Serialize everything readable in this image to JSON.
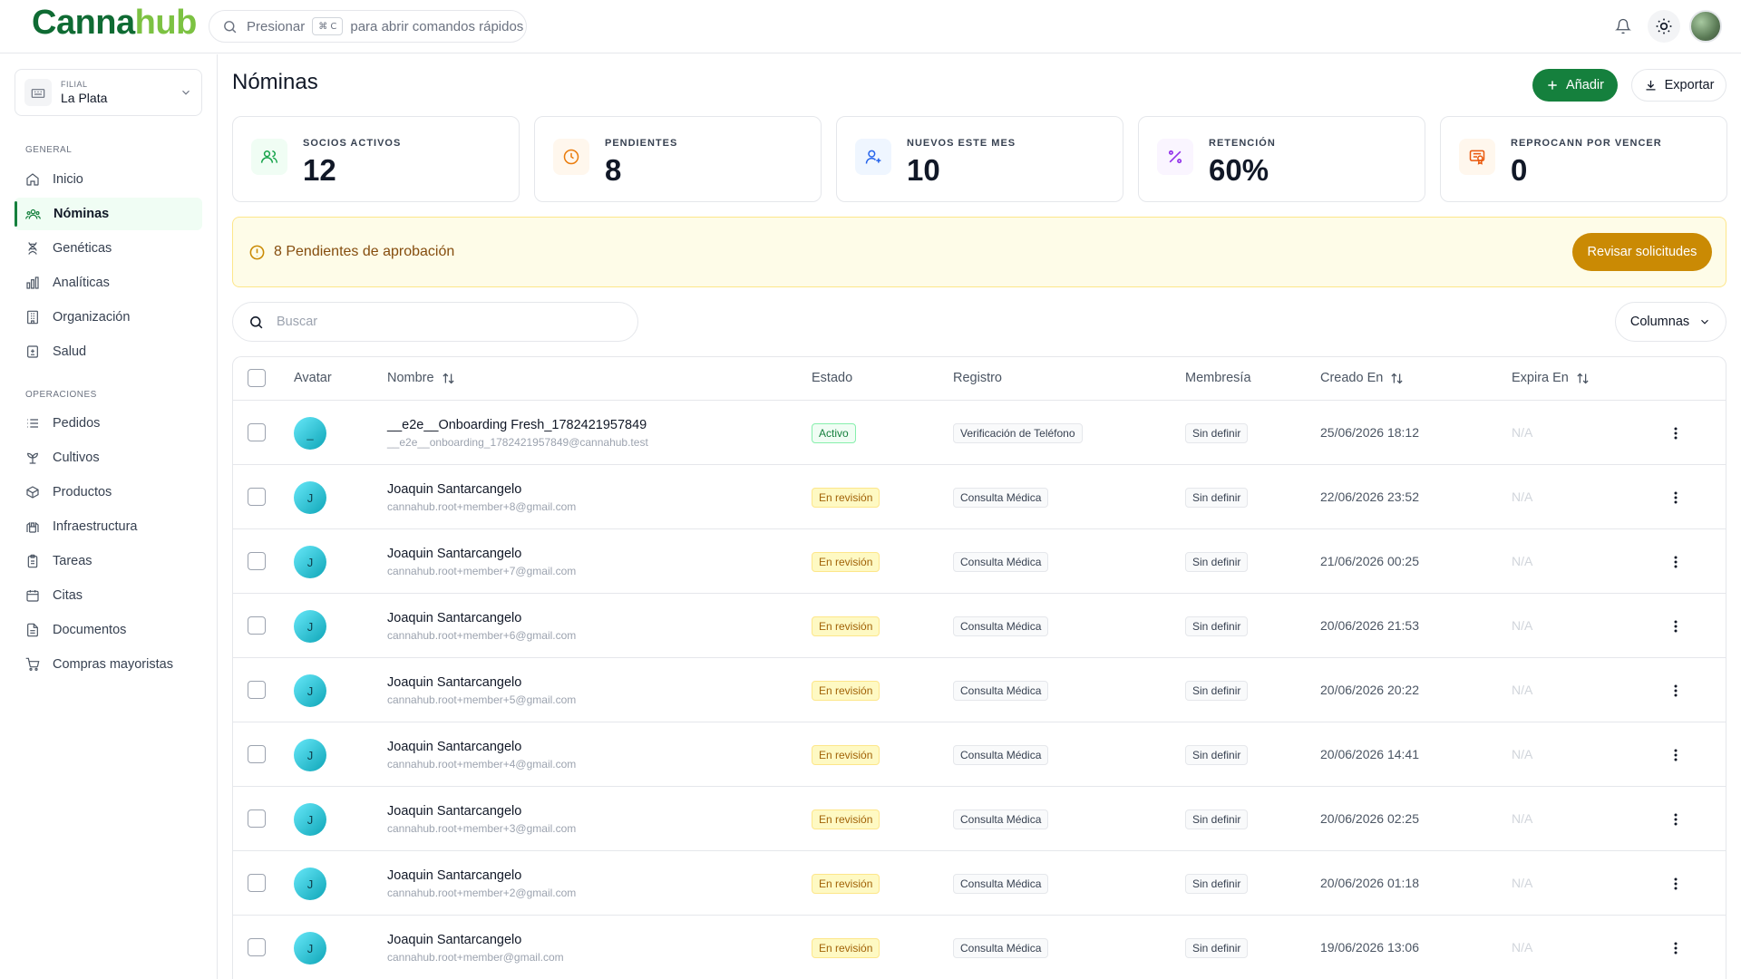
{
  "app": {
    "logo_main": "Canna",
    "logo_accent": "hub",
    "search_prefix": "Presionar",
    "search_shortcut": "⌘ C",
    "search_suffix": "para abrir comandos rápidos"
  },
  "sidebar": {
    "branch_label": "FILIAL",
    "branch_value": "La Plata",
    "section_general": "GENERAL",
    "section_operations": "OPERACIONES",
    "general_items": [
      {
        "label": "Inicio",
        "icon": "home-icon"
      },
      {
        "label": "Nóminas",
        "icon": "members-icon",
        "active": true
      },
      {
        "label": "Genéticas",
        "icon": "dna-icon"
      },
      {
        "label": "Analíticas",
        "icon": "chart-icon"
      },
      {
        "label": "Organización",
        "icon": "building-icon"
      },
      {
        "label": "Salud",
        "icon": "health-icon"
      }
    ],
    "operations_items": [
      {
        "label": "Pedidos",
        "icon": "list-icon"
      },
      {
        "label": "Cultivos",
        "icon": "sprout-icon"
      },
      {
        "label": "Productos",
        "icon": "package-icon"
      },
      {
        "label": "Infraestructura",
        "icon": "infrastructure-icon"
      },
      {
        "label": "Tareas",
        "icon": "clipboard-icon"
      },
      {
        "label": "Citas",
        "icon": "calendar-icon"
      },
      {
        "label": "Documentos",
        "icon": "document-icon"
      },
      {
        "label": "Compras mayoristas",
        "icon": "cart-icon"
      }
    ]
  },
  "main": {
    "title": "Nóminas",
    "add_label": "Añadir",
    "export_label": "Exportar",
    "stats": [
      {
        "label": "SOCIOS ACTIVOS",
        "value": "12",
        "icon": "users-icon",
        "color": "#16a34a",
        "bg": "#f0fdf4"
      },
      {
        "label": "PENDIENTES",
        "value": "8",
        "icon": "clock-icon",
        "color": "#ea7c0c",
        "bg": "#fff7ed"
      },
      {
        "label": "NUEVOS ESTE MES",
        "value": "10",
        "icon": "user-plus-icon",
        "color": "#2563eb",
        "bg": "#eff6ff"
      },
      {
        "label": "RETENCIÓN",
        "value": "60%",
        "icon": "percent-icon",
        "color": "#9333ea",
        "bg": "#faf5ff"
      },
      {
        "label": "REPROCANN POR VENCER",
        "value": "0",
        "icon": "certificate-icon",
        "color": "#ea580c",
        "bg": "#fff7ed"
      }
    ],
    "alert_text": "8 Pendientes de aprobación",
    "alert_button": "Revisar solicitudes",
    "search_placeholder": "Buscar",
    "columns_button": "Columnas"
  },
  "table": {
    "headers": {
      "avatar": "Avatar",
      "name": "Nombre",
      "status": "Estado",
      "registration": "Registro",
      "membership": "Membresía",
      "created": "Creado En",
      "expires": "Expira En"
    },
    "rows": [
      {
        "initial": "_",
        "name": "__e2e__Onboarding Fresh_1782421957849",
        "email": "__e2e__onboarding_1782421957849@cannahub.test",
        "status": "Activo",
        "registration": "Verificación de Teléfono",
        "membership": "Sin definir",
        "created": "25/06/2026 18:12",
        "expires": "N/A"
      },
      {
        "initial": "J",
        "name": "Joaquin Santarcangelo",
        "email": "cannahub.root+member+8@gmail.com",
        "status": "En revisión",
        "registration": "Consulta Médica",
        "membership": "Sin definir",
        "created": "22/06/2026 23:52",
        "expires": "N/A"
      },
      {
        "initial": "J",
        "name": "Joaquin Santarcangelo",
        "email": "cannahub.root+member+7@gmail.com",
        "status": "En revisión",
        "registration": "Consulta Médica",
        "membership": "Sin definir",
        "created": "21/06/2026 00:25",
        "expires": "N/A"
      },
      {
        "initial": "J",
        "name": "Joaquin Santarcangelo",
        "email": "cannahub.root+member+6@gmail.com",
        "status": "En revisión",
        "registration": "Consulta Médica",
        "membership": "Sin definir",
        "created": "20/06/2026 21:53",
        "expires": "N/A"
      },
      {
        "initial": "J",
        "name": "Joaquin Santarcangelo",
        "email": "cannahub.root+member+5@gmail.com",
        "status": "En revisión",
        "registration": "Consulta Médica",
        "membership": "Sin definir",
        "created": "20/06/2026 20:22",
        "expires": "N/A"
      },
      {
        "initial": "J",
        "name": "Joaquin Santarcangelo",
        "email": "cannahub.root+member+4@gmail.com",
        "status": "En revisión",
        "registration": "Consulta Médica",
        "membership": "Sin definir",
        "created": "20/06/2026 14:41",
        "expires": "N/A"
      },
      {
        "initial": "J",
        "name": "Joaquin Santarcangelo",
        "email": "cannahub.root+member+3@gmail.com",
        "status": "En revisión",
        "registration": "Consulta Médica",
        "membership": "Sin definir",
        "created": "20/06/2026 02:25",
        "expires": "N/A"
      },
      {
        "initial": "J",
        "name": "Joaquin Santarcangelo",
        "email": "cannahub.root+member+2@gmail.com",
        "status": "En revisión",
        "registration": "Consulta Médica",
        "membership": "Sin definir",
        "created": "20/06/2026 01:18",
        "expires": "N/A"
      },
      {
        "initial": "J",
        "name": "Joaquin Santarcangelo",
        "email": "cannahub.root+member@gmail.com",
        "status": "En revisión",
        "registration": "Consulta Médica",
        "membership": "Sin definir",
        "created": "19/06/2026 13:06",
        "expires": "N/A"
      }
    ]
  }
}
